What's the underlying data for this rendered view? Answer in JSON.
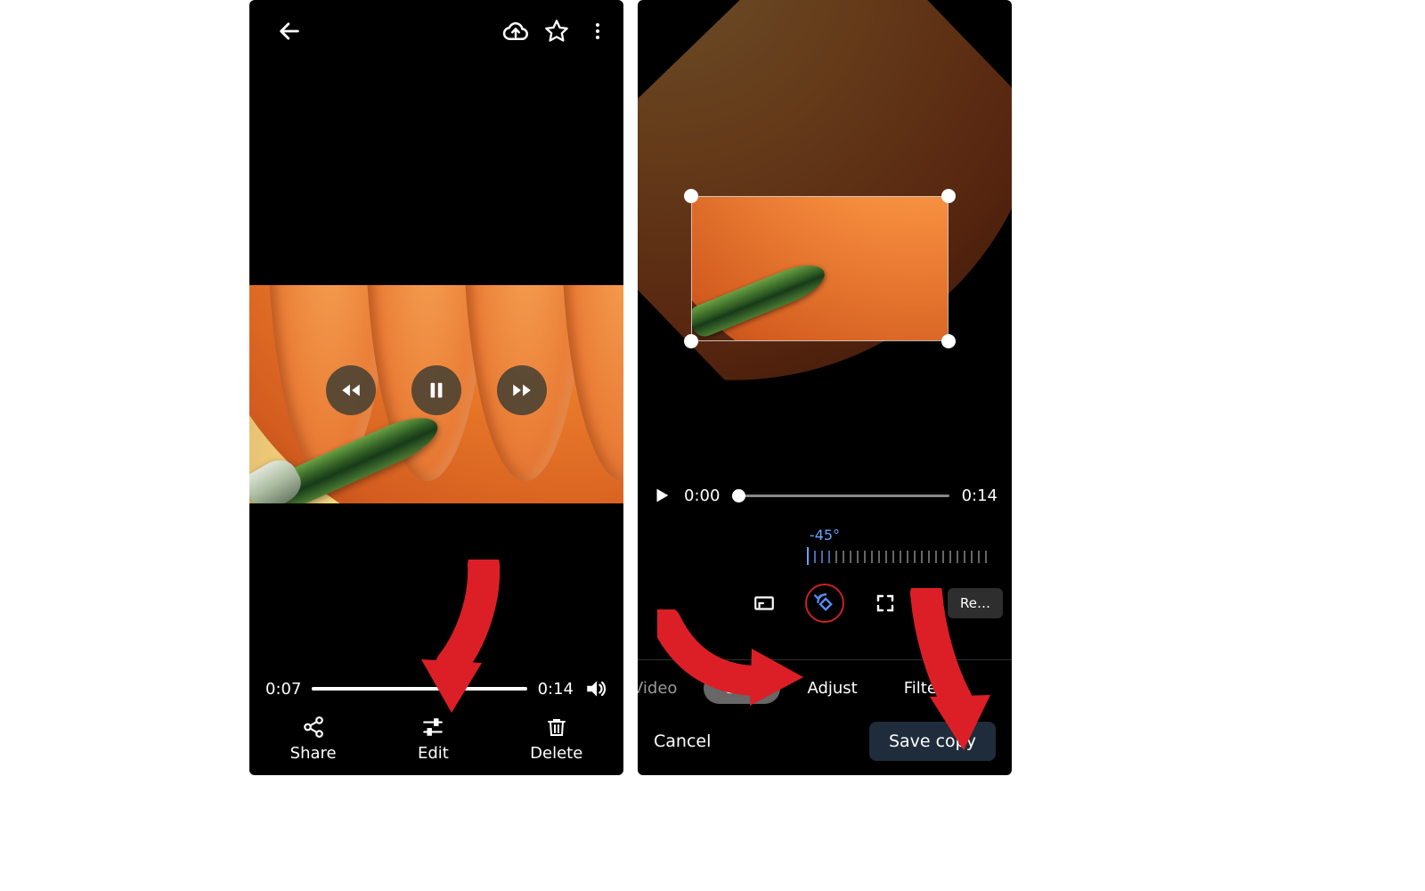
{
  "leftScreen": {
    "playback": {
      "currentTime": "0:07",
      "duration": "0:14"
    },
    "bottomActions": {
      "share": "Share",
      "edit": "Edit",
      "delete": "Delete"
    },
    "icons": {
      "back": "back-arrow-icon",
      "cloudUpload": "cloud-upload-icon",
      "favorite": "star-outline-icon",
      "overflow": "more-vert-icon",
      "rewind": "rewind-icon",
      "pause": "pause-icon",
      "forward": "fast-forward-icon",
      "volume": "volume-icon",
      "share": "share-icon",
      "edit": "tune-icon",
      "delete": "trash-icon"
    }
  },
  "rightScreen": {
    "playback": {
      "currentTime": "0:00",
      "duration": "0:14"
    },
    "rotation": {
      "angleLabel": "-45°",
      "valueDeg": -45
    },
    "cropTools": {
      "resetLabel": "Re…",
      "icons": {
        "aspect": "aspect-ratio-icon",
        "rotate": "rotate-ccw-icon",
        "expand": "fullscreen-icon"
      }
    },
    "tabs": {
      "video": "Video",
      "crop": "Crop",
      "adjust": "Adjust",
      "filters": "Filters",
      "activeTab": "crop"
    },
    "footer": {
      "cancel": "Cancel",
      "saveCopy": "Save copy"
    },
    "icons": {
      "play": "play-icon"
    }
  },
  "colors": {
    "annotationArrow": "#dc1f26",
    "accentBlue": "#6aa4ff",
    "saveBg": "#1f2c3c",
    "chipActive": "#676767"
  }
}
